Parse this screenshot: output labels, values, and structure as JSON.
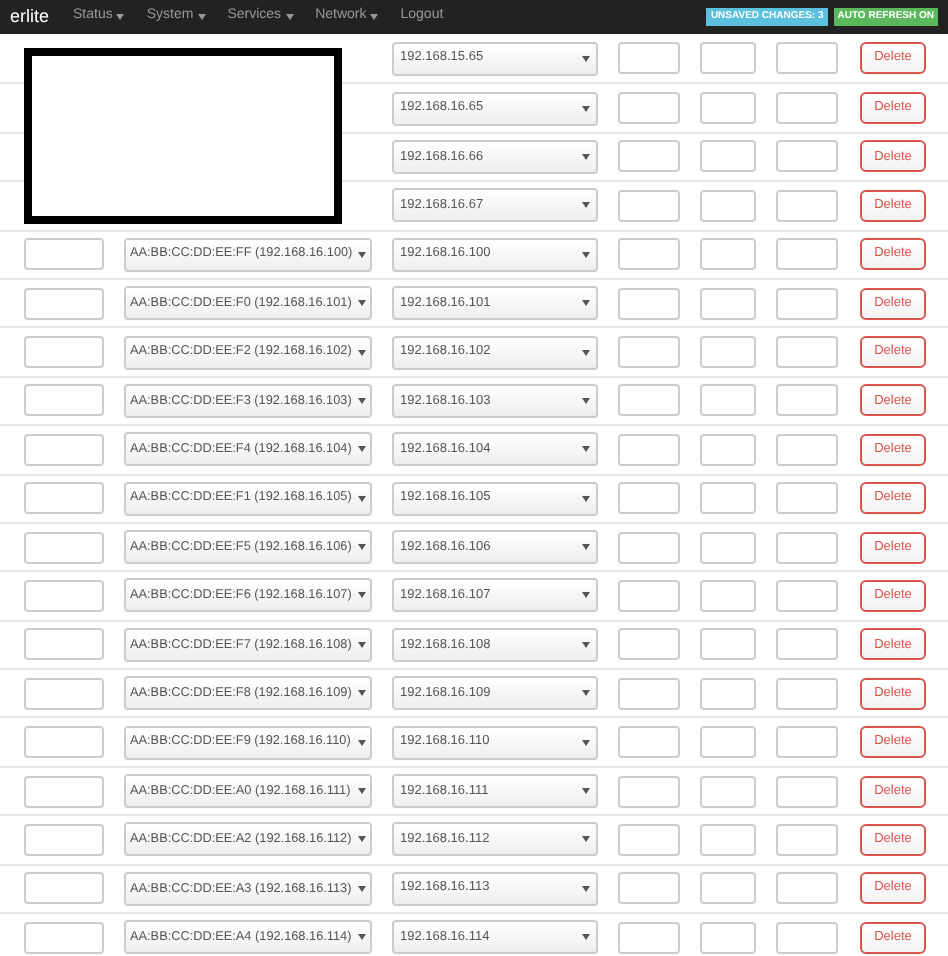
{
  "navbar": {
    "brand": "erlite",
    "menus": [
      {
        "label": "Status",
        "has_caret": true
      },
      {
        "label": "System",
        "has_caret": true
      },
      {
        "label": "Services",
        "has_caret": true
      },
      {
        "label": "Network",
        "has_caret": true
      },
      {
        "label": "Logout",
        "has_caret": false
      }
    ],
    "badges": [
      {
        "text": "UNSAVED CHANGES: 3",
        "color": "#5bc0de"
      },
      {
        "text": "AUTO REFRESH ON",
        "color": "#5cb85c"
      }
    ]
  },
  "rows": [
    {
      "redacted": true,
      "ip": "192.168.15.65",
      "action": "Delete"
    },
    {
      "redacted": true,
      "ip": "192.168.16.65",
      "action": "Delete"
    },
    {
      "redacted": true,
      "ip": "192.168.16.66",
      "action": "Delete"
    },
    {
      "redacted": true,
      "ip": "192.168.16.67",
      "action": "Delete"
    },
    {
      "mac": "AA:BB:CC:DD:EE:FF (192.168.16.100)",
      "ip": "192.168.16.100",
      "action": "Delete"
    },
    {
      "mac": "AA:BB:CC:DD:EE:F0 (192.168.16.101)",
      "ip": "192.168.16.101",
      "action": "Delete"
    },
    {
      "mac": "AA:BB:CC:DD:EE:F2 (192.168.16.102)",
      "ip": "192.168.16.102",
      "action": "Delete"
    },
    {
      "mac": "AA:BB:CC:DD:EE:F3 (192.168.16.103)",
      "ip": "192.168.16.103",
      "action": "Delete"
    },
    {
      "mac": "AA:BB:CC:DD:EE:F4 (192.168.16.104)",
      "ip": "192.168.16.104",
      "action": "Delete"
    },
    {
      "mac": "AA:BB:CC:DD:EE:F1 (192.168.16.105)",
      "ip": "192.168.16.105",
      "action": "Delete"
    },
    {
      "mac": "AA:BB:CC:DD:EE:F5 (192.168.16.106)",
      "ip": "192.168.16.106",
      "action": "Delete"
    },
    {
      "mac": "AA:BB:CC:DD:EE:F6 (192.168.16.107)",
      "ip": "192.168.16.107",
      "action": "Delete"
    },
    {
      "mac": "AA:BB:CC:DD:EE:F7 (192.168.16.108)",
      "ip": "192.168.16.108",
      "action": "Delete"
    },
    {
      "mac": "AA:BB:CC:DD:EE:F8 (192.168.16.109)",
      "ip": "192.168.16.109",
      "action": "Delete"
    },
    {
      "mac": "AA:BB:CC:DD:EE:F9 (192.168.16.110)",
      "ip": "192.168.16.110",
      "action": "Delete"
    },
    {
      "mac": "AA:BB:CC:DD:EE:A0 (192.168.16.111)",
      "ip": "192.168.16.111",
      "action": "Delete"
    },
    {
      "mac": "AA:BB:CC:DD:EE:A2 (192.168.16.112)",
      "ip": "192.168.16.112",
      "action": "Delete"
    },
    {
      "mac": "AA:BB:CC:DD:EE:A3 (192.168.16.113)",
      "ip": "192.168.16.113",
      "action": "Delete"
    },
    {
      "mac": "AA:BB:CC:DD:EE:A4 (192.168.16.114)",
      "ip": "192.168.16.114",
      "action": "Delete"
    }
  ]
}
